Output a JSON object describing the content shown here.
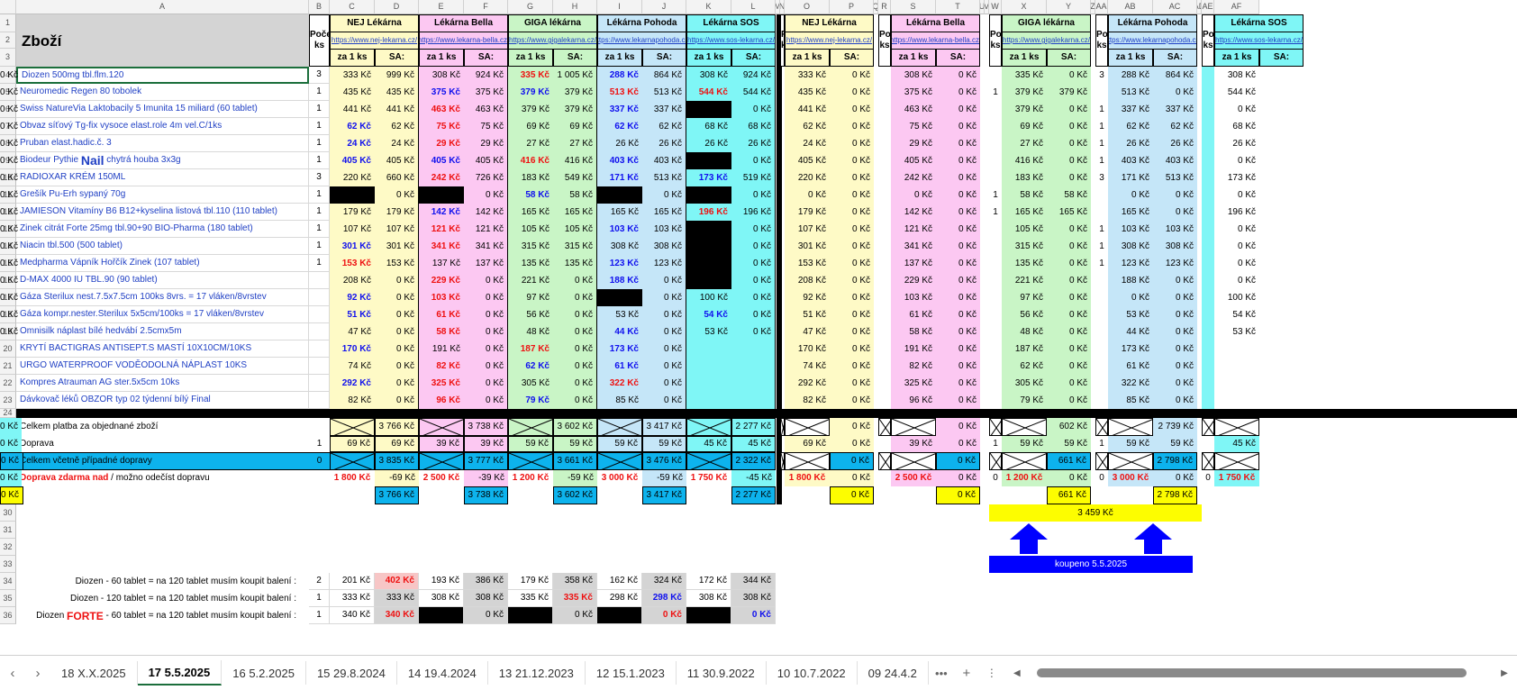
{
  "colors": {
    "yellow": "#fefac6",
    "pink": "#fcc8f2",
    "green": "#c9f5c6",
    "lblue": "#c5e6f8",
    "cyan": "#7ff6f6",
    "bluebar": "#0db3ed",
    "ygold": "#fdfd00",
    "navy": "#0000ff",
    "grey": "#d4d4d4",
    "pinkgrey": "#f7c6c6"
  },
  "col_headers": [
    "A",
    "B",
    "C",
    "D",
    "E",
    "F",
    "G",
    "H",
    "I",
    "J",
    "K",
    "L",
    "M",
    "N",
    "O",
    "P",
    "Q",
    "R",
    "S",
    "T",
    "U",
    "V",
    "W",
    "X",
    "Y",
    "Z",
    "AA",
    "AB",
    "AC",
    "AD",
    "AE",
    "AF"
  ],
  "row_numbers": [
    "1",
    "2",
    "3",
    "4",
    "5",
    "6",
    "7",
    "8",
    "9",
    "10",
    "11",
    "12",
    "13",
    "14",
    "15",
    "16",
    "17",
    "18",
    "19",
    "20",
    "21",
    "22",
    "23",
    "24",
    "25",
    "26",
    "27",
    "28",
    "29",
    "30",
    "31",
    "32",
    "33",
    "34",
    "35",
    "36"
  ],
  "header": {
    "zbozi": "Zboží",
    "pocet": "Počet ks",
    "za1": "za 1 ks",
    "sa": "SA:",
    "shops": [
      {
        "name": "NEJ Lékárna",
        "url": "https://www.nej-lekarna.cz/"
      },
      {
        "name": "Lékárna Bella",
        "url": "https://www.lekarna-bella.cz/"
      },
      {
        "name": "GIGA lékárna",
        "url": "https://www.gigalekarna.cz/"
      },
      {
        "name": "Lékárna Pohoda",
        "url": "https://www.lekarnapohoda.cz/"
      },
      {
        "name": "Lékárna SOS",
        "url": "https://www.sos-lekarna.cz/"
      }
    ]
  },
  "products": [
    {
      "name": "Diozen 500mg tbl.flm.120",
      "qty": "3",
      "left": [
        "333 Kč",
        "999 Kč",
        "308 Kč",
        "924 Kč",
        "335 Kč",
        "1 005 Kč",
        "288 Kč",
        "864 Kč",
        "308 Kč",
        "924 Kč"
      ],
      "lc": [
        "",
        "",
        "",
        "",
        "red",
        "",
        "blue",
        "",
        "",
        ""
      ],
      "qty2": [
        "",
        "",
        "",
        "3",
        ""
      ],
      "right": [
        "333 Kč",
        "0 Kč",
        "308 Kč",
        "0 Kč",
        "335 Kč",
        "0 Kč",
        "288 Kč",
        "864 Kč",
        "308 Kč",
        "0 Kč"
      ]
    },
    {
      "name": "Neuromedic Regen 80 tobolek",
      "qty": "1",
      "left": [
        "435 Kč",
        "435 Kč",
        "375 Kč",
        "375 Kč",
        "379 Kč",
        "379 Kč",
        "513 Kč",
        "513 Kč",
        "544 Kč",
        "544 Kč"
      ],
      "lc": [
        "",
        "",
        "blue",
        "",
        "blue",
        "",
        "red",
        "",
        "red",
        ""
      ],
      "qty2": [
        "",
        "",
        "1",
        "",
        ""
      ],
      "right": [
        "435 Kč",
        "0 Kč",
        "375 Kč",
        "0 Kč",
        "379 Kč",
        "379 Kč",
        "513 Kč",
        "0 Kč",
        "544 Kč",
        "0 Kč"
      ]
    },
    {
      "name": "Swiss NatureVia Laktobacily 5 Imunita 15 miliard (60 tablet)",
      "qty": "1",
      "left": [
        "441 Kč",
        "441 Kč",
        "463 Kč",
        "463 Kč",
        "379 Kč",
        "379 Kč",
        "337 Kč",
        "337 Kč",
        "",
        "0 Kč"
      ],
      "lc": [
        "",
        "",
        "red",
        "",
        "",
        "",
        "blue",
        "",
        "black",
        ""
      ],
      "qty2": [
        "",
        "",
        "",
        "1",
        ""
      ],
      "right": [
        "441 Kč",
        "0 Kč",
        "463 Kč",
        "0 Kč",
        "379 Kč",
        "0 Kč",
        "337 Kč",
        "337 Kč",
        "0 Kč",
        "0 Kč"
      ]
    },
    {
      "name": "Obvaz síťový Tg-fix vysoce elast.role 4m vel.C/1ks",
      "qty": "1",
      "left": [
        "62 Kč",
        "62 Kč",
        "75 Kč",
        "75 Kč",
        "69 Kč",
        "69 Kč",
        "62 Kč",
        "62 Kč",
        "68 Kč",
        "68 Kč"
      ],
      "lc": [
        "blue",
        "",
        "red",
        "",
        "",
        "",
        "blue",
        "",
        "",
        ""
      ],
      "qty2": [
        "",
        "",
        "",
        "1",
        ""
      ],
      "right": [
        "62 Kč",
        "0 Kč",
        "75 Kč",
        "0 Kč",
        "69 Kč",
        "0 Kč",
        "62 Kč",
        "62 Kč",
        "68 Kč",
        "0 Kč"
      ]
    },
    {
      "name": "Pruban elast.hadic.č. 3",
      "qty": "1",
      "left": [
        "24 Kč",
        "24 Kč",
        "29 Kč",
        "29 Kč",
        "27 Kč",
        "27 Kč",
        "26 Kč",
        "26 Kč",
        "26 Kč",
        "26 Kč"
      ],
      "lc": [
        "blue",
        "",
        "red",
        "",
        "",
        "",
        "",
        "",
        "",
        ""
      ],
      "qty2": [
        "",
        "",
        "",
        "1",
        ""
      ],
      "right": [
        "24 Kč",
        "0 Kč",
        "29 Kč",
        "0 Kč",
        "27 Kč",
        "0 Kč",
        "26 Kč",
        "26 Kč",
        "26 Kč",
        "0 Kč"
      ]
    },
    {
      "name": "Biodeur Pythie ",
      "nail": "Nail",
      "name2": " chytrá houba 3x3g",
      "qty": "1",
      "left": [
        "405 Kč",
        "405 Kč",
        "405 Kč",
        "405 Kč",
        "416 Kč",
        "416 Kč",
        "403 Kč",
        "403 Kč",
        "",
        "0 Kč"
      ],
      "lc": [
        "blue",
        "",
        "blue",
        "",
        "red",
        "",
        "blue",
        "",
        "black",
        ""
      ],
      "qty2": [
        "",
        "",
        "",
        "1",
        ""
      ],
      "right": [
        "405 Kč",
        "0 Kč",
        "405 Kč",
        "0 Kč",
        "416 Kč",
        "0 Kč",
        "403 Kč",
        "403 Kč",
        "0 Kč",
        "0 Kč"
      ]
    },
    {
      "name": "RADIOXAR KRÉM 150ML",
      "qty": "3",
      "left": [
        "220 Kč",
        "660 Kč",
        "242 Kč",
        "726 Kč",
        "183 Kč",
        "549 Kč",
        "171 Kč",
        "513 Kč",
        "173 Kč",
        "519 Kč"
      ],
      "lc": [
        "",
        "",
        "red",
        "",
        "",
        "",
        "blue",
        "",
        "blue",
        ""
      ],
      "qty2": [
        "",
        "",
        "",
        "3",
        ""
      ],
      "right": [
        "220 Kč",
        "0 Kč",
        "242 Kč",
        "0 Kč",
        "183 Kč",
        "0 Kč",
        "171 Kč",
        "513 Kč",
        "173 Kč",
        "0 Kč"
      ]
    },
    {
      "name": "Grešík Pu-Erh sypaný 70g",
      "qty": "1",
      "left": [
        "",
        "0 Kč",
        "",
        "0 Kč",
        "58 Kč",
        "58 Kč",
        "",
        "0 Kč",
        "",
        "0 Kč"
      ],
      "lc": [
        "black",
        "",
        "black",
        "",
        "blue",
        "",
        "black",
        "",
        "black",
        ""
      ],
      "qty2": [
        "",
        "",
        "1",
        "",
        ""
      ],
      "right": [
        "0 Kč",
        "0 Kč",
        "0 Kč",
        "0 Kč",
        "58 Kč",
        "58 Kč",
        "0 Kč",
        "0 Kč",
        "0 Kč",
        "0 Kč"
      ]
    },
    {
      "name": "JAMIESON Vitamíny B6 B12+kyselina listová tbl.110 (110 tablet)",
      "qty": "1",
      "left": [
        "179 Kč",
        "179 Kč",
        "142 Kč",
        "142 Kč",
        "165 Kč",
        "165 Kč",
        "165 Kč",
        "165 Kč",
        "196 Kč",
        "196 Kč"
      ],
      "lc": [
        "",
        "",
        "blue",
        "",
        "",
        "",
        "",
        "",
        "red",
        ""
      ],
      "qty2": [
        "",
        "",
        "1",
        "",
        ""
      ],
      "right": [
        "179 Kč",
        "0 Kč",
        "142 Kč",
        "0 Kč",
        "165 Kč",
        "165 Kč",
        "165 Kč",
        "0 Kč",
        "196 Kč",
        "0 Kč"
      ]
    },
    {
      "name": "Zinek citrát Forte 25mg tbl.90+90 BIO-Pharma (180 tablet)",
      "qty": "1",
      "left": [
        "107 Kč",
        "107 Kč",
        "121 Kč",
        "121 Kč",
        "105 Kč",
        "105 Kč",
        "103 Kč",
        "103 Kč",
        "",
        "0 Kč"
      ],
      "lc": [
        "",
        "",
        "red",
        "",
        "",
        "",
        "blue",
        "",
        "black",
        ""
      ],
      "qty2": [
        "",
        "",
        "",
        "1",
        ""
      ],
      "right": [
        "107 Kč",
        "0 Kč",
        "121 Kč",
        "0 Kč",
        "105 Kč",
        "0 Kč",
        "103 Kč",
        "103 Kč",
        "0 Kč",
        "0 Kč"
      ]
    },
    {
      "name": "Niacin tbl.500 (500 tablet)",
      "qty": "1",
      "left": [
        "301 Kč",
        "301 Kč",
        "341 Kč",
        "341 Kč",
        "315 Kč",
        "315 Kč",
        "308 Kč",
        "308 Kč",
        "",
        "0 Kč"
      ],
      "lc": [
        "blue",
        "",
        "red",
        "",
        "",
        "",
        "",
        "",
        "black",
        ""
      ],
      "qty2": [
        "",
        "",
        "",
        "1",
        ""
      ],
      "right": [
        "301 Kč",
        "0 Kč",
        "341 Kč",
        "0 Kč",
        "315 Kč",
        "0 Kč",
        "308 Kč",
        "308 Kč",
        "0 Kč",
        "0 Kč"
      ]
    },
    {
      "name": "Medpharma Vápník Hořčík Zinek (107 tablet)",
      "qty": "1",
      "left": [
        "153 Kč",
        "153 Kč",
        "137 Kč",
        "137 Kč",
        "135 Kč",
        "135 Kč",
        "123 Kč",
        "123 Kč",
        "",
        "0 Kč"
      ],
      "lc": [
        "red",
        "",
        "",
        "",
        "",
        "",
        "blue",
        "",
        "black",
        ""
      ],
      "qty2": [
        "",
        "",
        "",
        "1",
        ""
      ],
      "right": [
        "153 Kč",
        "0 Kč",
        "137 Kč",
        "0 Kč",
        "135 Kč",
        "0 Kč",
        "123 Kč",
        "123 Kč",
        "0 Kč",
        "0 Kč"
      ]
    },
    {
      "name": "D-MAX 4000 IU TBL.90 (90 tablet)",
      "qty": "",
      "left": [
        "208 Kč",
        "0 Kč",
        "229 Kč",
        "0 Kč",
        "221 Kč",
        "0 Kč",
        "188 Kč",
        "0 Kč",
        "",
        "0 Kč"
      ],
      "lc": [
        "",
        "",
        "red",
        "",
        "",
        "",
        "blue",
        "",
        "black",
        ""
      ],
      "qty2": [
        "",
        "",
        "",
        "",
        ""
      ],
      "right": [
        "208 Kč",
        "0 Kč",
        "229 Kč",
        "0 Kč",
        "221 Kč",
        "0 Kč",
        "188 Kč",
        "0 Kč",
        "0 Kč",
        "0 Kč"
      ]
    },
    {
      "name": "Gáza Sterilux nest.7.5x7.5cm 100ks 8vrs. = 17 vláken/8vrstev",
      "qty": "",
      "left": [
        "92 Kč",
        "0 Kč",
        "103 Kč",
        "0 Kč",
        "97 Kč",
        "0 Kč",
        "",
        "0 Kč",
        "100 Kč",
        "0 Kč"
      ],
      "lc": [
        "blue",
        "",
        "red",
        "",
        "",
        "",
        "black",
        "",
        "",
        ""
      ],
      "qty2": [
        "",
        "",
        "",
        "",
        ""
      ],
      "right": [
        "92 Kč",
        "0 Kč",
        "103 Kč",
        "0 Kč",
        "97 Kč",
        "0 Kč",
        "0 Kč",
        "0 Kč",
        "100 Kč",
        "0 Kč"
      ]
    },
    {
      "name": "Gáza kompr.nester.Sterilux 5x5cm/100ks = 17 vláken/8vrstev",
      "qty": "",
      "left": [
        "51 Kč",
        "0 Kč",
        "61 Kč",
        "0 Kč",
        "56 Kč",
        "0 Kč",
        "53 Kč",
        "0 Kč",
        "54 Kč",
        "0 Kč"
      ],
      "lc": [
        "blue",
        "",
        "red",
        "",
        "",
        "",
        "",
        "",
        "blue",
        ""
      ],
      "qty2": [
        "",
        "",
        "",
        "",
        ""
      ],
      "right": [
        "51 Kč",
        "0 Kč",
        "61 Kč",
        "0 Kč",
        "56 Kč",
        "0 Kč",
        "53 Kč",
        "0 Kč",
        "54 Kč",
        "0 Kč"
      ]
    },
    {
      "name": "Omnisilk náplast bílé hedvábí 2.5cmx5m",
      "qty": "",
      "left": [
        "47 Kč",
        "0 Kč",
        "58 Kč",
        "0 Kč",
        "48 Kč",
        "0 Kč",
        "44 Kč",
        "0 Kč",
        "53 Kč",
        "0 Kč"
      ],
      "lc": [
        "",
        "",
        "red",
        "",
        "",
        "",
        "blue",
        "",
        "",
        ""
      ],
      "qty2": [
        "",
        "",
        "",
        "",
        ""
      ],
      "right": [
        "47 Kč",
        "0 Kč",
        "58 Kč",
        "0 Kč",
        "48 Kč",
        "0 Kč",
        "44 Kč",
        "0 Kč",
        "53 Kč",
        "0 Kč"
      ]
    },
    {
      "name": "KRYTÍ BACTIGRAS ANTISEPT.S MASTÍ 10X10CM/10KS",
      "qty": "",
      "left": [
        "170 Kč",
        "0 Kč",
        "191 Kč",
        "0 Kč",
        "187 Kč",
        "0 Kč",
        "173 Kč",
        "0 Kč",
        "",
        ""
      ],
      "lc": [
        "blue",
        "",
        "",
        "",
        "red",
        "",
        "blue",
        "",
        "",
        ""
      ],
      "qty2": [
        "",
        "",
        "",
        "",
        ""
      ],
      "right": [
        "170 Kč",
        "0 Kč",
        "191 Kč",
        "0 Kč",
        "187 Kč",
        "0 Kč",
        "173 Kč",
        "0 Kč",
        "",
        ""
      ]
    },
    {
      "name": "URGO WATERPROOF VODĚODOLNÁ NÁPLAST 10KS",
      "qty": "",
      "left": [
        "74 Kč",
        "0 Kč",
        "82 Kč",
        "0 Kč",
        "62 Kč",
        "0 Kč",
        "61 Kč",
        "0 Kč",
        "",
        ""
      ],
      "lc": [
        "",
        "",
        "red",
        "",
        "blue",
        "",
        "blue",
        "",
        "",
        ""
      ],
      "qty2": [
        "",
        "",
        "",
        "",
        ""
      ],
      "right": [
        "74 Kč",
        "0 Kč",
        "82 Kč",
        "0 Kč",
        "62 Kč",
        "0 Kč",
        "61 Kč",
        "0 Kč",
        "",
        ""
      ]
    },
    {
      "name": "Kompres Atrauman AG ster.5x5cm 10ks",
      "qty": "",
      "left": [
        "292 Kč",
        "0 Kč",
        "325 Kč",
        "0 Kč",
        "305 Kč",
        "0 Kč",
        "322 Kč",
        "0 Kč",
        "",
        ""
      ],
      "lc": [
        "blue",
        "",
        "red",
        "",
        "",
        "",
        "red",
        "",
        "",
        ""
      ],
      "qty2": [
        "",
        "",
        "",
        "",
        ""
      ],
      "right": [
        "292 Kč",
        "0 Kč",
        "325 Kč",
        "0 Kč",
        "305 Kč",
        "0 Kč",
        "322 Kč",
        "0 Kč",
        "",
        ""
      ]
    },
    {
      "name": "Dávkovač léků OBZOR typ 02 týdenní bílý Final",
      "qty": "",
      "left": [
        "82 Kč",
        "0 Kč",
        "96 Kč",
        "0 Kč",
        "79 Kč",
        "0 Kč",
        "85 Kč",
        "0 Kč",
        "",
        ""
      ],
      "lc": [
        "",
        "",
        "red",
        "",
        "blue",
        "",
        "",
        "",
        "",
        ""
      ],
      "qty2": [
        "",
        "",
        "",
        "",
        ""
      ],
      "right": [
        "82 Kč",
        "0 Kč",
        "96 Kč",
        "0 Kč",
        "79 Kč",
        "0 Kč",
        "85 Kč",
        "0 Kč",
        "",
        ""
      ]
    }
  ],
  "summary": {
    "celkem_label": "Celkem platba za objednané zboží",
    "celkem_left": [
      "3 766 Kč",
      "3 738 Kč",
      "3 602 Kč",
      "3 417 Kč",
      "2 277 Kč"
    ],
    "celkem_right": [
      "0 Kč",
      "0 Kč",
      "602 Kč",
      "2 739 Kč",
      "0 Kč"
    ],
    "doprava_label": "Doprava",
    "doprava_qty": "1",
    "doprava_left": [
      "69 Kč",
      "69 Kč",
      "39 Kč",
      "39 Kč",
      "59 Kč",
      "59 Kč",
      "59 Kč",
      "59 Kč",
      "45 Kč",
      "45 Kč"
    ],
    "doprava_qty2": [
      "",
      "",
      "1",
      "1",
      ""
    ],
    "doprava_right": [
      "69 Kč",
      "0 Kč",
      "39 Kč",
      "0 Kč",
      "59 Kč",
      "59 Kč",
      "59 Kč",
      "59 Kč",
      "45 Kč",
      "0 Kč"
    ],
    "vcetne_label": "Celkem včetně případné dopravy",
    "vcetne_qty": "0",
    "vcetne_left": [
      "3 835 Kč",
      "3 777 Kč",
      "3 661 Kč",
      "3 476 Kč",
      "2 322 Kč"
    ],
    "vcetne_right": [
      "0 Kč",
      "0 Kč",
      "661 Kč",
      "2 798 Kč",
      "0 Kč"
    ],
    "zdarma_label_red": "Doprava zdarma nad",
    "zdarma_label_rest": " / možno odečíst dopravu",
    "zdarma_left": [
      "1 800 Kč",
      "-69 Kč",
      "2 500 Kč",
      "-39 Kč",
      "1 200 Kč",
      "-59 Kč",
      "3 000 Kč",
      "-59 Kč",
      "1 750 Kč",
      "-45 Kč"
    ],
    "zdarma_qty2": [
      "",
      "",
      "0",
      "0",
      "0"
    ],
    "zdarma_right": [
      "1 800 Kč",
      "0 Kč",
      "2 500 Kč",
      "0 Kč",
      "1 200 Kč",
      "0 Kč",
      "3 000 Kč",
      "0 Kč",
      "1 750 Kč",
      "0 Kč"
    ],
    "r29_left": [
      "3 766 Kč",
      "3 738 Kč",
      "3 602 Kč",
      "3 417 Kč",
      "2 277 Kč"
    ],
    "r29_right": [
      "0 Kč",
      "0 Kč",
      "661 Kč",
      "2 798 Kč",
      "0 Kč"
    ],
    "total_yellow": "3 459 Kč",
    "koupeno": "koupeno 5.5.2025"
  },
  "diozen": [
    {
      "label": "Diozen - 60 tablet = na 120 tablet musím koupit balení :",
      "qty": "2",
      "vals": [
        "201 Kč",
        "402 Kč",
        "193 Kč",
        "386 Kč",
        "179 Kč",
        "358 Kč",
        "162 Kč",
        "324 Kč",
        "172 Kč",
        "344 Kč"
      ],
      "vc": [
        "",
        "red",
        "",
        "",
        "",
        "",
        "",
        "",
        "",
        ""
      ]
    },
    {
      "label": "Diozen - 120 tablet = na 120 tablet musím koupit balení :",
      "qty": "1",
      "vals": [
        "333 Kč",
        "333 Kč",
        "308 Kč",
        "308 Kč",
        "335 Kč",
        "335 Kč",
        "298 Kč",
        "298 Kč",
        "308 Kč",
        "308 Kč"
      ],
      "vc": [
        "",
        "",
        "",
        "",
        "",
        "red",
        "",
        "blue",
        "",
        ""
      ]
    },
    {
      "label_a": "Diozen ",
      "label_forte": "FORTE",
      "label_b": " - 60 tablet = na 120 tablet musím koupit balení :",
      "qty": "1",
      "vals": [
        "340 Kč",
        "340 Kč",
        "",
        "0 Kč",
        "",
        "0 Kč",
        "",
        "0 Kč",
        "",
        "0 Kč"
      ],
      "vc": [
        "",
        "red",
        "black",
        "",
        "black",
        "",
        "black",
        "red",
        "black",
        "blue"
      ]
    }
  ],
  "tabs": [
    "18 X.X.2025",
    "17 5.5.2025",
    "16 5.2.2025",
    "15 29.8.2024",
    "14 19.4.2024",
    "13 21.12.2023",
    "12 15.1.2023",
    "11 30.9.2022",
    "10 10.7.2022",
    "09 24.4.2"
  ],
  "active_tab": "17 5.5.2025"
}
